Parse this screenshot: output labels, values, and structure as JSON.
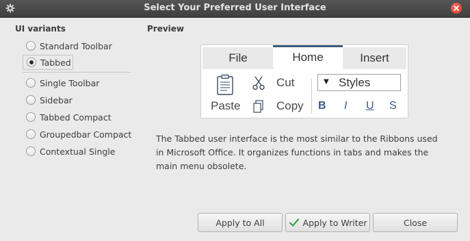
{
  "window": {
    "title": "Select Your Preferred User Interface"
  },
  "variants": {
    "heading": "UI variants",
    "items": [
      {
        "label": "Standard Toolbar",
        "checked": false
      },
      {
        "label": "Tabbed",
        "checked": true
      },
      {
        "label": "Single Toolbar",
        "checked": false
      },
      {
        "label": "Sidebar",
        "checked": false
      },
      {
        "label": "Tabbed Compact",
        "checked": false
      },
      {
        "label": "Groupedbar Compact",
        "checked": false
      },
      {
        "label": "Contextual Single",
        "checked": false
      }
    ]
  },
  "preview": {
    "heading": "Preview",
    "tabs": [
      "File",
      "Home",
      "Insert"
    ],
    "active_tab": "Home",
    "paste_label": "Paste",
    "cut_label": "Cut",
    "copy_label": "Copy",
    "styles_label": "Styles",
    "bold_label": "B",
    "italic_label": "I",
    "underline_label": "U",
    "strike_label": "S"
  },
  "description": "The Tabbed user interface is the most similar to the Ribbons used in Microsoft Office. It organizes functions in tabs and makes the main menu obsolete.",
  "buttons": {
    "apply_all": "Apply to All",
    "apply_writer": "Apply to Writer",
    "close": "Close"
  },
  "icons": {
    "settings": "gear-icon",
    "close": "close-icon",
    "paste": "clipboard-icon",
    "cut": "scissors-icon",
    "copy": "copy-icon",
    "apply": "checkmark-icon"
  },
  "colors": {
    "titlebar": "#444444",
    "close_button": "#e0483a",
    "active_tab_bar": "#3a5a7c",
    "check": "#3aa34a"
  }
}
